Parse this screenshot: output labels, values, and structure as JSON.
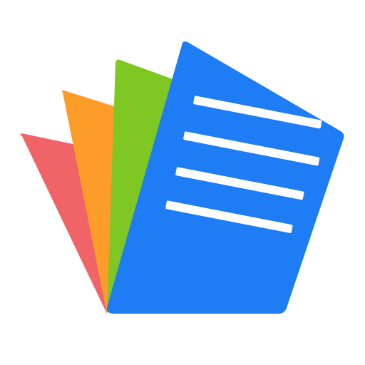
{
  "app_icon": {
    "icon_name": "document-stack-icon",
    "background_color": "#ffffff",
    "pages": [
      {
        "name": "red-page",
        "color": "#f06468"
      },
      {
        "name": "orange-page",
        "color": "#fd9c29"
      },
      {
        "name": "green-page",
        "color": "#7fc723"
      },
      {
        "name": "blue-page",
        "color": "#1e7cf4"
      }
    ],
    "text_lines": {
      "color": "#ffffff",
      "count": 4
    }
  }
}
